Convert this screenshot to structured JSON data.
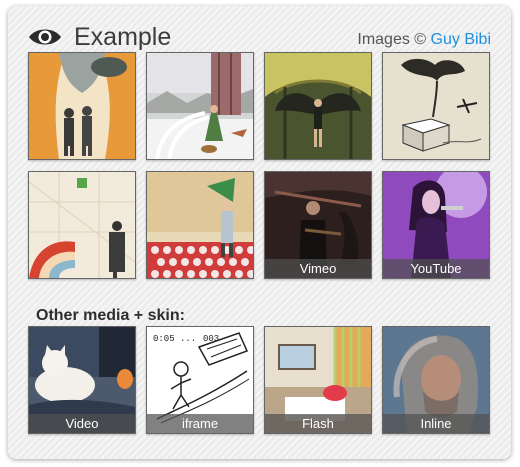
{
  "header": {
    "title": "Example",
    "eye_icon": "eye-icon",
    "credit_prefix": "Images ©",
    "credit_link": "Guy Bibi",
    "link_color": "#1f8fe0"
  },
  "gallery": {
    "thumbnails": [
      {
        "alt": "divers-in-orange-landscape"
      },
      {
        "alt": "woman-with-dogs-near-tower"
      },
      {
        "alt": "winged-figure-in-domed-hall"
      },
      {
        "alt": "ink-tree-and-airplane"
      },
      {
        "alt": "man-on-map-with-rainbow"
      },
      {
        "alt": "soldier-on-red-pattern"
      },
      {
        "caption": "Vimeo"
      },
      {
        "caption": "YouTube"
      }
    ]
  },
  "other_media": {
    "label": "Other media + skin:",
    "items": [
      {
        "caption": "Video"
      },
      {
        "caption": "iframe"
      },
      {
        "caption": "Flash"
      },
      {
        "caption": "Inline"
      }
    ]
  }
}
